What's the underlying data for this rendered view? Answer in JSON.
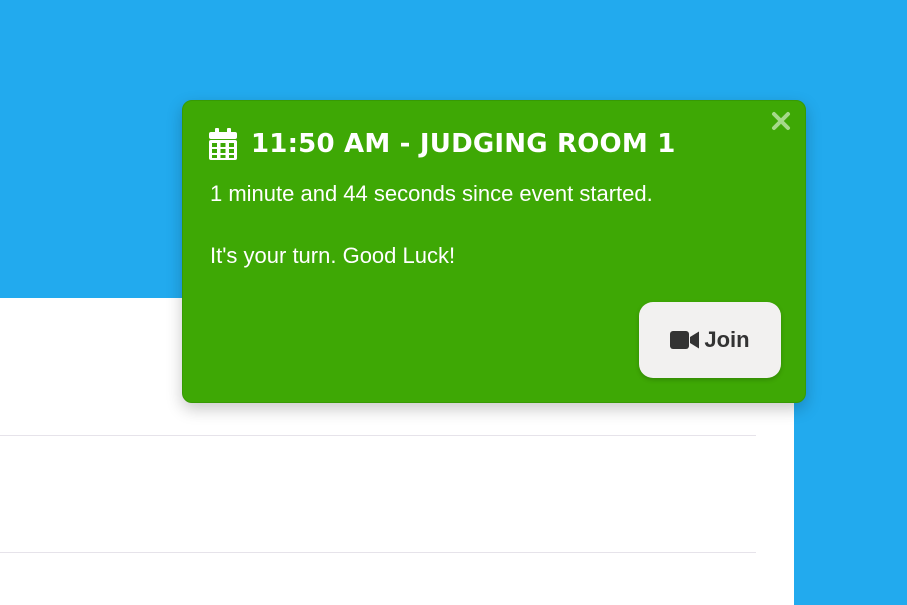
{
  "notification": {
    "title": "11:50 AM - JUDGING ROOM 1",
    "elapsed": "1 minute and 44 seconds since event started.",
    "message": "It's your turn. Good Luck!",
    "join_label": "Join",
    "close_icon": "close-icon",
    "title_icon": "calendar-icon",
    "join_icon": "video-camera-icon"
  },
  "colors": {
    "page_background": "#22aaee",
    "notification_background": "#3ea805",
    "notification_text": "#ffffff",
    "join_button_background": "#f2f1f0",
    "join_button_text": "#333333",
    "close_icon": "#a6d98a"
  }
}
